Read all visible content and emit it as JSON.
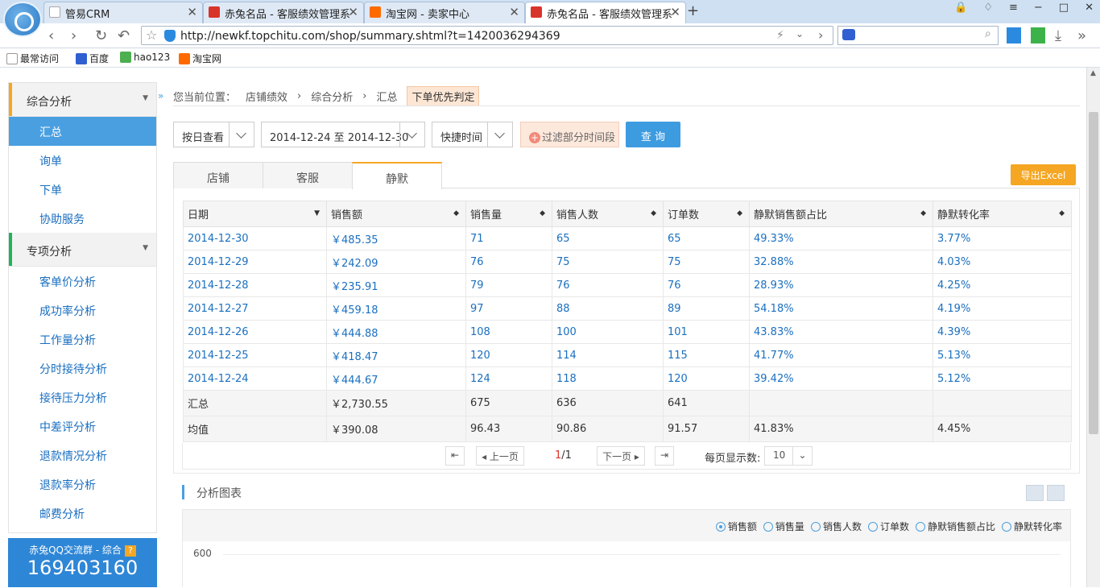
{
  "browser": {
    "tabs": [
      {
        "title": "管易CRM",
        "active": false
      },
      {
        "title": "赤兔名品 - 客服绩效管理系",
        "active": false
      },
      {
        "title": "淘宝网 - 卖家中心",
        "active": false
      },
      {
        "title": "赤兔名品 - 客服绩效管理系",
        "active": true
      }
    ],
    "url": "http://newkf.topchitu.com/shop/summary.shtml?t=1420036294369",
    "bookmarks": [
      "最常访问",
      "百度",
      "hao123",
      "淘宝网"
    ]
  },
  "sidebar": {
    "sections": [
      {
        "label": "综合分析",
        "items": [
          "汇总",
          "询单",
          "下单",
          "协助服务"
        ]
      },
      {
        "label": "专项分析",
        "items": [
          "客单价分析",
          "成功率分析",
          "工作量分析",
          "分时接待分析",
          "接待压力分析",
          "中差评分析",
          "退款情况分析",
          "退款率分析",
          "邮费分析"
        ]
      }
    ],
    "active_item": "汇总",
    "qq_group": {
      "title": "赤兔QQ交流群 - 综合",
      "number": "169403160",
      "help": "?"
    }
  },
  "breadcrumb": {
    "prefix": "您当前位置：",
    "items": [
      "店铺绩效",
      "综合分析",
      "汇总"
    ],
    "tag": "下单优先判定"
  },
  "filters": {
    "mode": "按日查看",
    "date_range": "2014-12-24 至 2014-12-30",
    "quick_time": "快捷时间",
    "exclude_label": "过滤部分时间段",
    "query_label": "查 询"
  },
  "tabs": [
    "店铺",
    "客服",
    "静默"
  ],
  "active_tab": "静默",
  "export_label": "导出Excel",
  "table": {
    "columns": [
      "日期",
      "销售额",
      "销售量",
      "销售人数",
      "订单数",
      "静默销售额占比",
      "静默转化率"
    ],
    "rows": [
      [
        "2014-12-30",
        "￥485.35",
        "71",
        "65",
        "65",
        "49.33%",
        "3.77%"
      ],
      [
        "2014-12-29",
        "￥242.09",
        "76",
        "75",
        "75",
        "32.88%",
        "4.03%"
      ],
      [
        "2014-12-28",
        "￥235.91",
        "79",
        "76",
        "76",
        "28.93%",
        "4.25%"
      ],
      [
        "2014-12-27",
        "￥459.18",
        "97",
        "88",
        "89",
        "54.18%",
        "4.19%"
      ],
      [
        "2014-12-26",
        "￥444.88",
        "108",
        "100",
        "101",
        "43.83%",
        "4.39%"
      ],
      [
        "2014-12-25",
        "￥418.47",
        "120",
        "114",
        "115",
        "41.77%",
        "5.13%"
      ],
      [
        "2014-12-24",
        "￥444.67",
        "124",
        "118",
        "120",
        "39.42%",
        "5.12%"
      ]
    ],
    "summary": [
      [
        "汇总",
        "￥2,730.55",
        "675",
        "636",
        "641",
        "",
        ""
      ],
      [
        "均值",
        "￥390.08",
        "96.43",
        "90.86",
        "91.57",
        "41.83%",
        "4.45%"
      ]
    ]
  },
  "pager": {
    "prev": "上一页",
    "next": "下一页",
    "current": "1",
    "total": "/1",
    "per_page_label": "每页显示数:",
    "per_page": "10"
  },
  "chart_panel": {
    "title": "分析图表",
    "metrics": [
      "销售额",
      "销售量",
      "销售人数",
      "订单数",
      "静默销售额占比",
      "静默转化率"
    ],
    "selected_metric": "销售额",
    "y_tick": "600"
  }
}
